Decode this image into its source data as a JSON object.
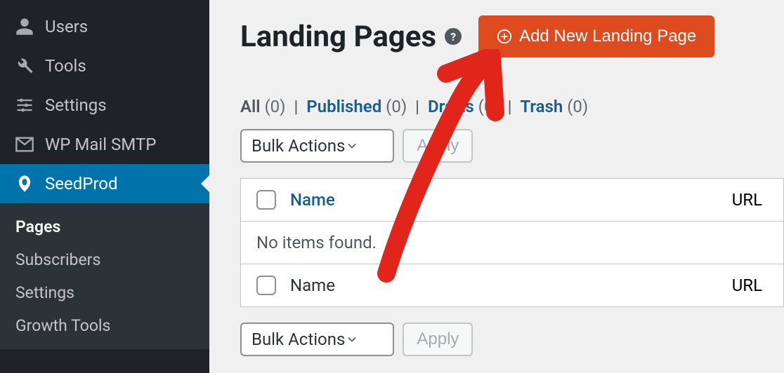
{
  "sidebar": {
    "items": [
      {
        "label": "Users",
        "icon": "user-icon"
      },
      {
        "label": "Tools",
        "icon": "wrench-icon"
      },
      {
        "label": "Settings",
        "icon": "sliders-icon"
      },
      {
        "label": "WP Mail SMTP",
        "icon": "mail-icon"
      },
      {
        "label": "SeedProd",
        "icon": "seedprod-icon"
      }
    ],
    "submenu": [
      {
        "label": "Pages"
      },
      {
        "label": "Subscribers"
      },
      {
        "label": "Settings"
      },
      {
        "label": "Growth Tools"
      }
    ]
  },
  "header": {
    "title": "Landing Pages",
    "help": "?",
    "add_button": "Add New Landing Page"
  },
  "filters": {
    "all_label": "All",
    "all_count": "(0)",
    "published_label": "Published",
    "published_count": "(0)",
    "drafts_label": "Drafts",
    "drafts_count": "(0)",
    "trash_label": "Trash",
    "trash_count": "(0)"
  },
  "bulk": {
    "select_label": "Bulk Actions",
    "apply_label": "Apply"
  },
  "table": {
    "col_name": "Name",
    "col_url": "URL",
    "empty": "No items found."
  }
}
